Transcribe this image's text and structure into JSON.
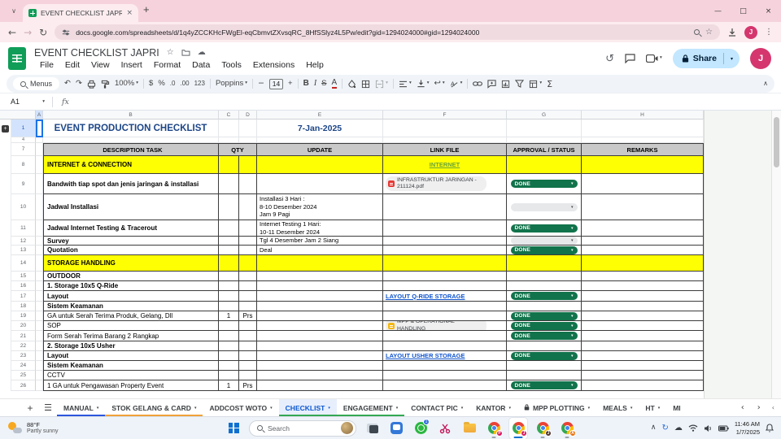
{
  "browser": {
    "tab_title": "EVENT CHECKLIST JAPRI - Goog",
    "url": "docs.google.com/spreadsheets/d/1q4yZCCKHcFWgEl-eqCbmvtZXvsqRC_8HfSSlyz4L5Pw/edit?gid=1294024000#gid=1294024000",
    "profile_initial": "J"
  },
  "app": {
    "title": "EVENT CHECKLIST JAPRI",
    "menus": [
      "File",
      "Edit",
      "View",
      "Insert",
      "Format",
      "Data",
      "Tools",
      "Extensions",
      "Help"
    ],
    "share_label": "Share",
    "avatar_initial": "J"
  },
  "toolbar": {
    "menus_label": "Menus",
    "zoom": "100%",
    "currency": "$",
    "percent": "%",
    "dec_less": ".0",
    "dec_more": ".00",
    "num_fmt": "123",
    "font": "Poppins",
    "font_size": "14",
    "bold": "B",
    "italic": "I",
    "strike": "S",
    "text_color": "A",
    "sum": "Σ"
  },
  "formula_bar": {
    "cell_ref": "A1",
    "fx_label": "fx"
  },
  "grid": {
    "columns": [
      "A",
      "B",
      "C",
      "D",
      "E",
      "F",
      "G",
      "H"
    ],
    "row1_num": "1",
    "hidden_row_num": "4",
    "header_row_num": "7",
    "title": "EVENT PRODUCTION CHECKLIST",
    "date": "7-Jan-2025",
    "header": {
      "desc": "DESCRIPTION TASK",
      "qty": "QTY",
      "update": "UPDATE",
      "link": "LINK FILE",
      "status": "APPROVAL / STATUS",
      "remarks": "REMARKS"
    },
    "status_done_label": "DONE",
    "rows": [
      {
        "num": "8",
        "h": 22,
        "section": true,
        "desc": "INTERNET & CONNECTION",
        "link": {
          "type": "glink",
          "text": "INTERNET"
        }
      },
      {
        "num": "9",
        "h": 25,
        "desc": "Bandwith tiap spot dan jenis jaringan & installasi",
        "bold": true,
        "link": {
          "type": "chip",
          "icon": "pdf",
          "text": "INFRASTRUKTUR JARINGAN - 211124.pdf"
        },
        "status": "done"
      },
      {
        "num": "10",
        "h": 32,
        "desc": "Jadwal Installasi",
        "bold": true,
        "update": [
          "Installasi 3 Hari :",
          "8-10 Desember 2024",
          "Jam 9 Pagi"
        ],
        "status": "blank"
      },
      {
        "num": "11",
        "h": 20,
        "desc": "Jadwal Internet Testing & Tracerout",
        "bold": true,
        "update": [
          "Internet Testing 1 Hari:",
          "10-11 Desember 2024"
        ],
        "status": "done"
      },
      {
        "num": "12",
        "h": 11,
        "desc": "Survey",
        "bold": true,
        "update": [
          "Tgl 4 Desember Jam 2 Siang"
        ],
        "status": "blank"
      },
      {
        "num": "13",
        "h": 12,
        "desc": "Quotation",
        "bold": true,
        "update": [
          "Deal"
        ],
        "status": "done"
      },
      {
        "num": "14",
        "h": 20,
        "section": true,
        "desc": "STORAGE HANDLING"
      },
      {
        "num": "15",
        "h": 12,
        "desc": "OUTDOOR",
        "bold": true
      },
      {
        "num": "16",
        "h": 12,
        "desc": "1. Storage 10x5 Q-Ride",
        "bold": true
      },
      {
        "num": "17",
        "h": 13,
        "desc": "Layout",
        "bold": true,
        "link": {
          "type": "blink",
          "text": "LAYOUT Q-RIDE STORAGE"
        },
        "status": "done"
      },
      {
        "num": "18",
        "h": 12,
        "desc": "Sistem Keamanan",
        "bold": true
      },
      {
        "num": "19",
        "h": 12,
        "desc": "GA untuk Serah Terima Produk, Gelang, Dll",
        "qty": "1",
        "unit": "Prs",
        "status": "done"
      },
      {
        "num": "20",
        "h": 12,
        "desc": "SOP",
        "link": {
          "type": "chip",
          "icon": "doc",
          "text": "MPP & OPERATIONAL HANDLING"
        },
        "status": "done"
      },
      {
        "num": "21",
        "h": 13,
        "desc": "Form Serah Terima Barang 2 Rangkap",
        "status": "done"
      },
      {
        "num": "22",
        "h": 12,
        "desc": "2. Storage 10x5 Usher",
        "bold": true
      },
      {
        "num": "23",
        "h": 12,
        "desc": "Layout",
        "bold": true,
        "link": {
          "type": "blink",
          "text": "LAYOUT USHER STORAGE"
        },
        "status": "done"
      },
      {
        "num": "24",
        "h": 12,
        "desc": "Sistem Keamanan",
        "bold": true
      },
      {
        "num": "25",
        "h": 12,
        "desc": "CCTV"
      },
      {
        "num": "26",
        "h": 13,
        "desc": "1 GA untuk Pengawasan Property Event",
        "qty": "1",
        "unit": "Prs",
        "status": "done"
      }
    ]
  },
  "sheet_tabs": {
    "items": [
      {
        "label": "MANUAL",
        "dropdown": true,
        "color": "#2c56dd"
      },
      {
        "label": "STOK GELANG & CARD",
        "dropdown": true,
        "color": "#f0a13a"
      },
      {
        "label": "ADDCOST WOTO",
        "dropdown": true
      },
      {
        "label": "CHECKLIST",
        "dropdown": true,
        "color": "#34a853",
        "active": true
      },
      {
        "label": "ENGAGEMENT",
        "dropdown": true,
        "color": "#34a853"
      },
      {
        "label": "CONTACT PIC",
        "dropdown": true
      },
      {
        "label": "KANTOR",
        "dropdown": true
      },
      {
        "label": "MPP PLOTTING",
        "dropdown": true,
        "locked": true
      },
      {
        "label": "MEALS",
        "dropdown": true
      },
      {
        "label": "HT",
        "dropdown": true
      },
      {
        "label": "MI"
      }
    ]
  },
  "taskbar": {
    "weather_temp": "88°F",
    "weather_cond": "Partly sunny",
    "search_placeholder": "Search",
    "whatsapp_badge": "1",
    "chrome_profiles": [
      "P",
      "J",
      "J",
      "A"
    ],
    "time": "11:46 AM",
    "date": "1/7/2025"
  }
}
